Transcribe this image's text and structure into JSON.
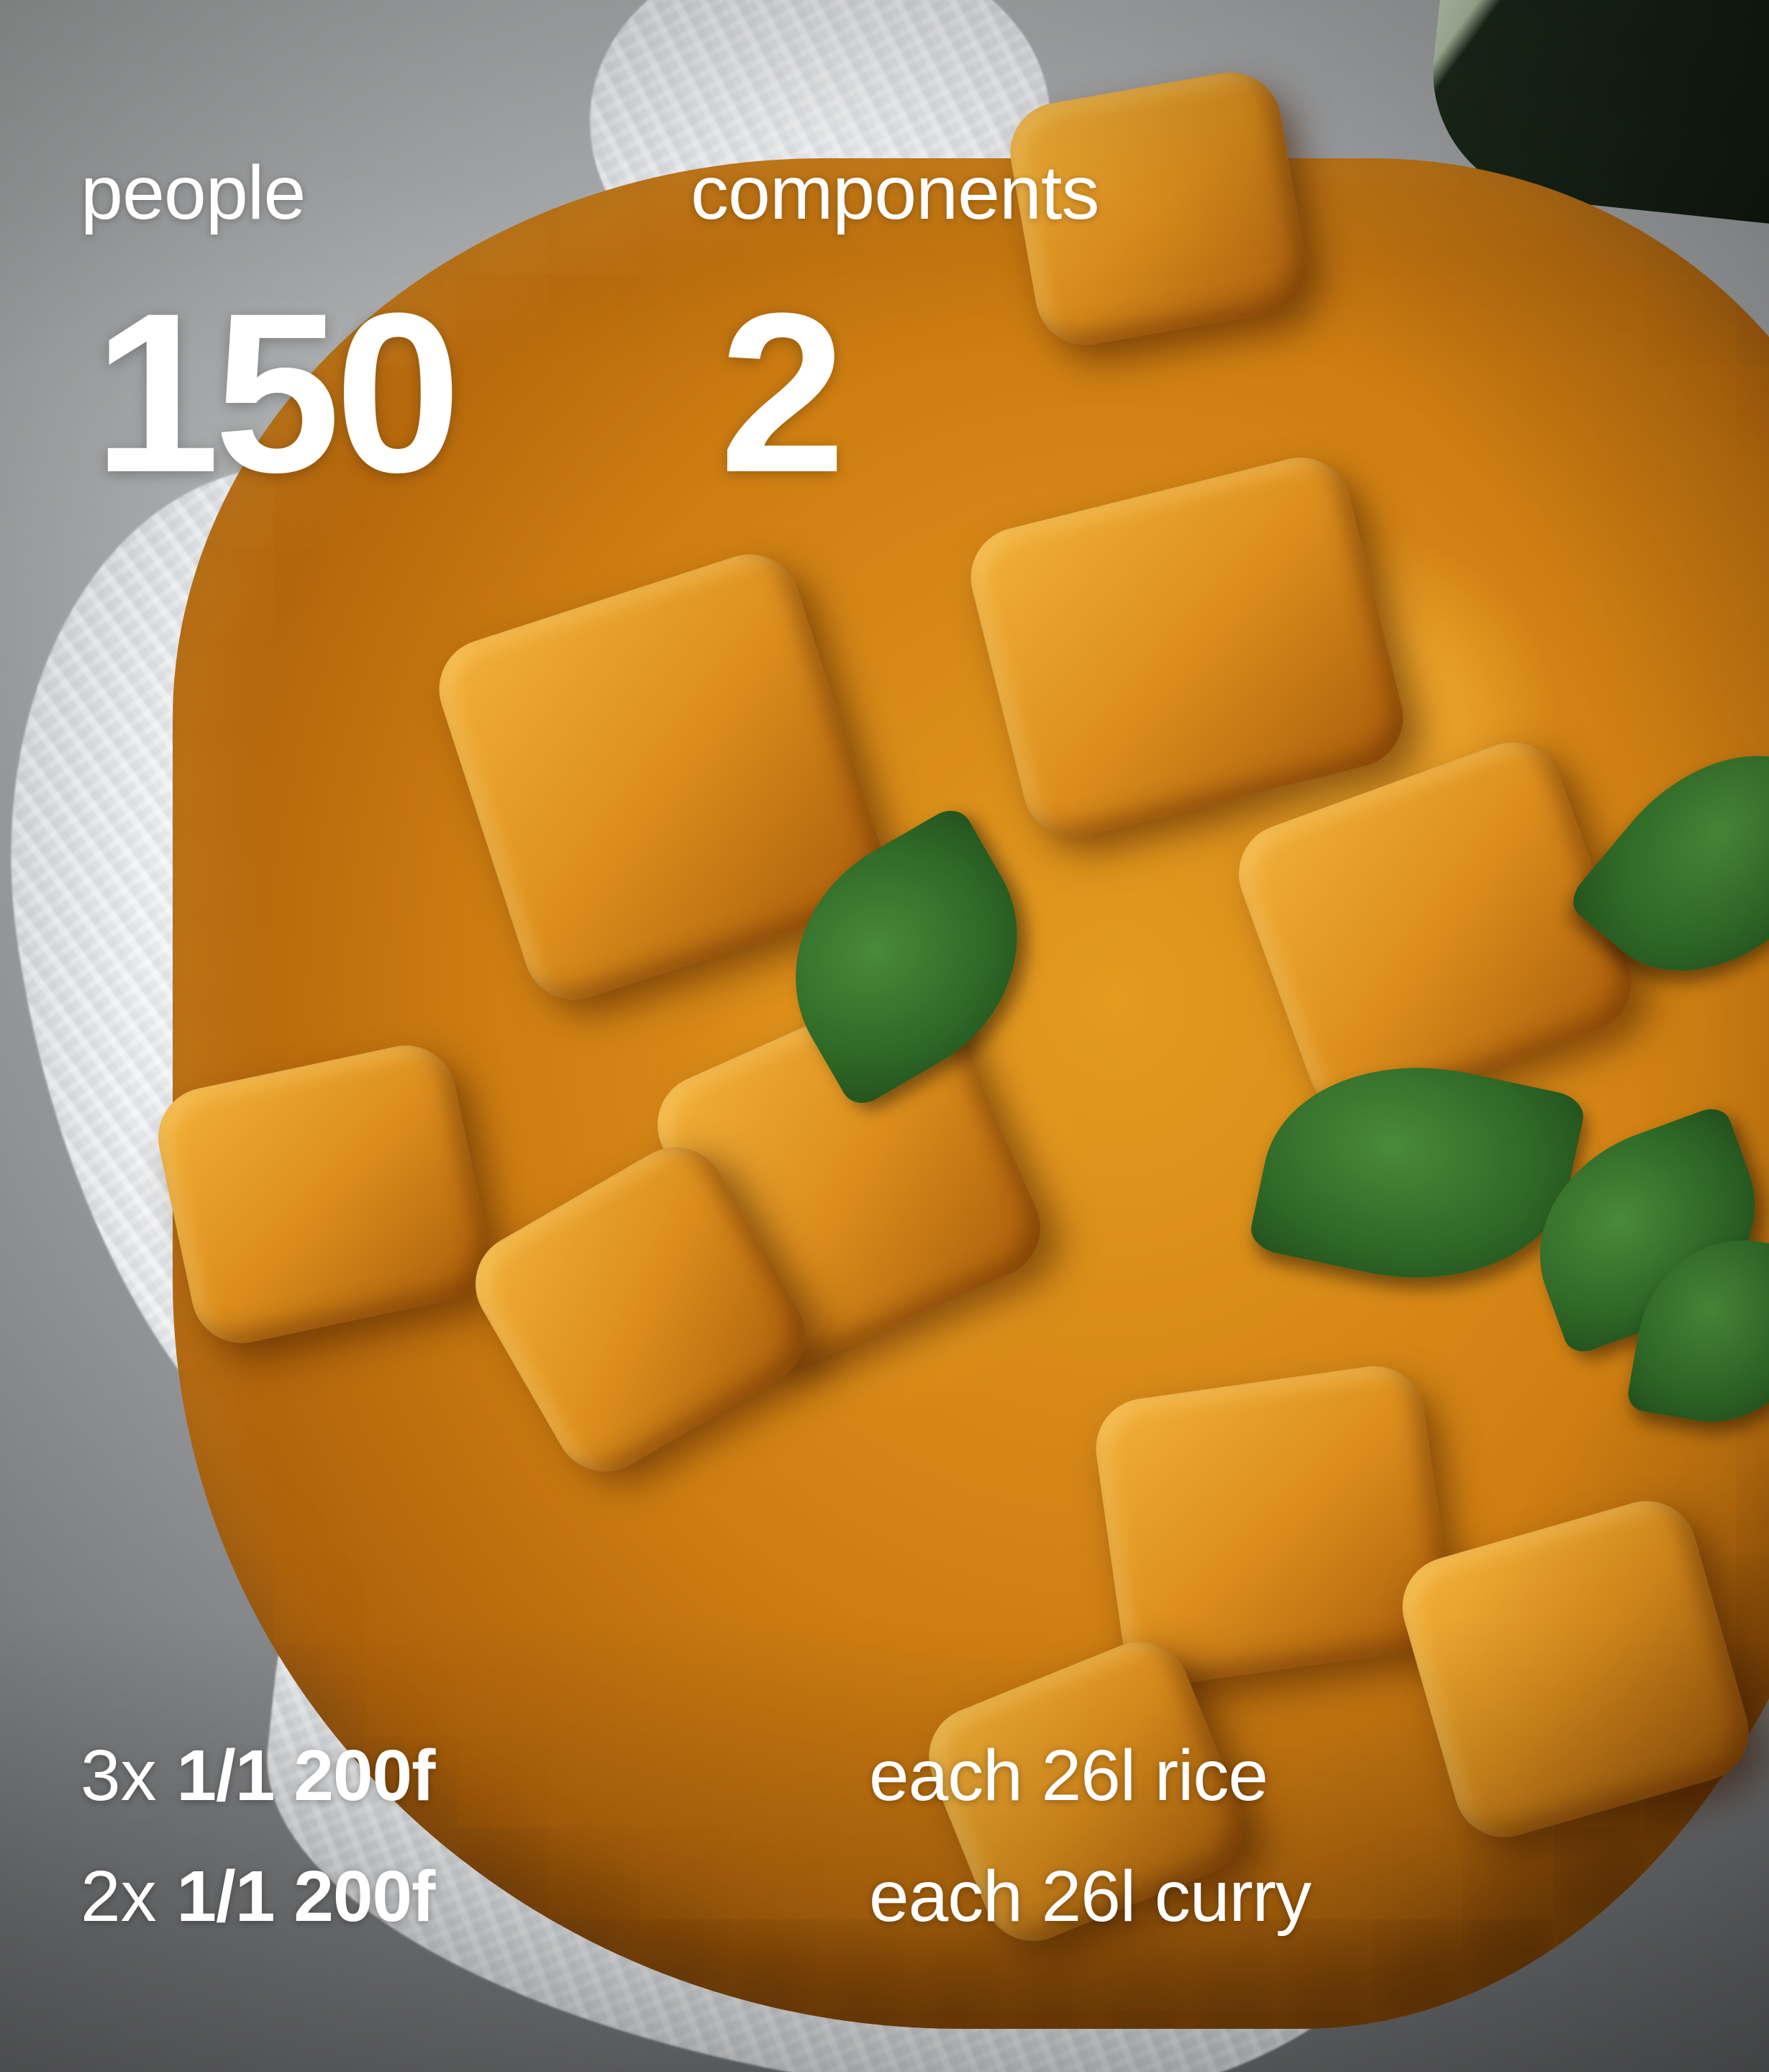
{
  "stats": [
    {
      "label": "people",
      "value": "150"
    },
    {
      "label": "components",
      "value": "2"
    }
  ],
  "containers": [
    {
      "quantity": "3x",
      "spec": "1/1 200f",
      "description": "each 26l rice"
    },
    {
      "quantity": "2x",
      "spec": "1/1 200f",
      "description": "each 26l curry"
    }
  ]
}
